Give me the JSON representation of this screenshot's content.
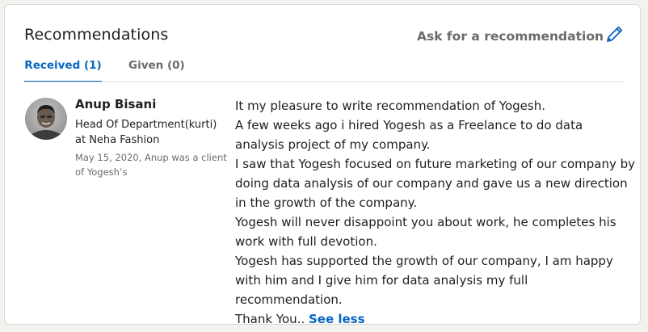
{
  "section": {
    "title": "Recommendations",
    "ask_label": "Ask for a recommendation"
  },
  "tabs": [
    {
      "label": "Received (1)",
      "selected": true
    },
    {
      "label": "Given (0)",
      "selected": false
    }
  ],
  "recommendation": {
    "author_name": "Anup Bisani",
    "author_headline": "Head Of Department(kurti) at Neha Fashion",
    "meta": "May 15, 2020, Anup was a client of Yogesh’s",
    "lines": [
      "It my pleasure to write recommendation of Yogesh.",
      "A few weeks ago i hired Yogesh as a Freelance to do data analysis project of my company.",
      "I saw that Yogesh focused on future marketing of our company by doing data analysis of our company and gave us a new direction in the growth of the company.",
      "Yogesh will never disappoint you about work, he completes his work with full devotion.",
      "Yogesh has supported the growth of our company, I am happy with him and I give him for data analysis my full recommendation."
    ],
    "closing": "Thank You..",
    "see_less_label": "See less"
  },
  "colors": {
    "accent": "#0a66c2",
    "muted": "#6b6b6b",
    "text": "#1f1f1f"
  },
  "icons": {
    "edit": "pencil-icon"
  }
}
